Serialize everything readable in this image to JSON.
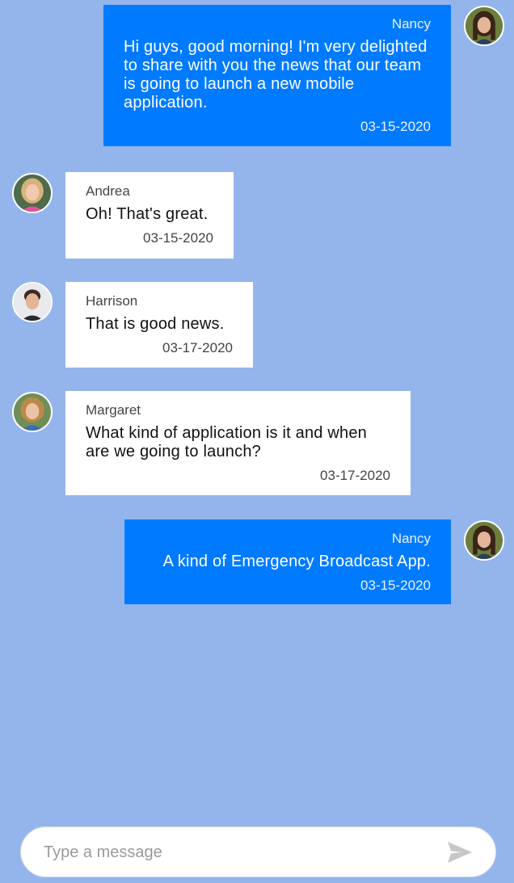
{
  "messages": [
    {
      "author": "Nancy",
      "text": "Hi guys, good morning! I'm very delighted to share with you the news that our team is going to launch a new mobile application.",
      "time": "03-15-2020",
      "avatar_icon": "woman-dark-hair-avatar"
    },
    {
      "author": "Andrea",
      "text": "Oh! That's great.",
      "time": "03-15-2020",
      "avatar_icon": "woman-blonde-avatar"
    },
    {
      "author": "Harrison",
      "text": "That is good news.",
      "time": "03-17-2020",
      "avatar_icon": "man-avatar"
    },
    {
      "author": "Margaret",
      "text": "What kind of application is it and when are we going to launch?",
      "time": "03-17-2020",
      "avatar_icon": "woman-curly-hair-avatar"
    },
    {
      "author": "Nancy",
      "text": "A kind of Emergency Broadcast App.",
      "time": "03-15-2020",
      "avatar_icon": "woman-dark-hair-avatar"
    }
  ],
  "composer": {
    "placeholder": "Type a message",
    "send_icon": "send-icon"
  },
  "colors": {
    "background": "#94b5ec",
    "outgoing_bubble": "#007bff",
    "incoming_bubble": "#ffffff"
  }
}
